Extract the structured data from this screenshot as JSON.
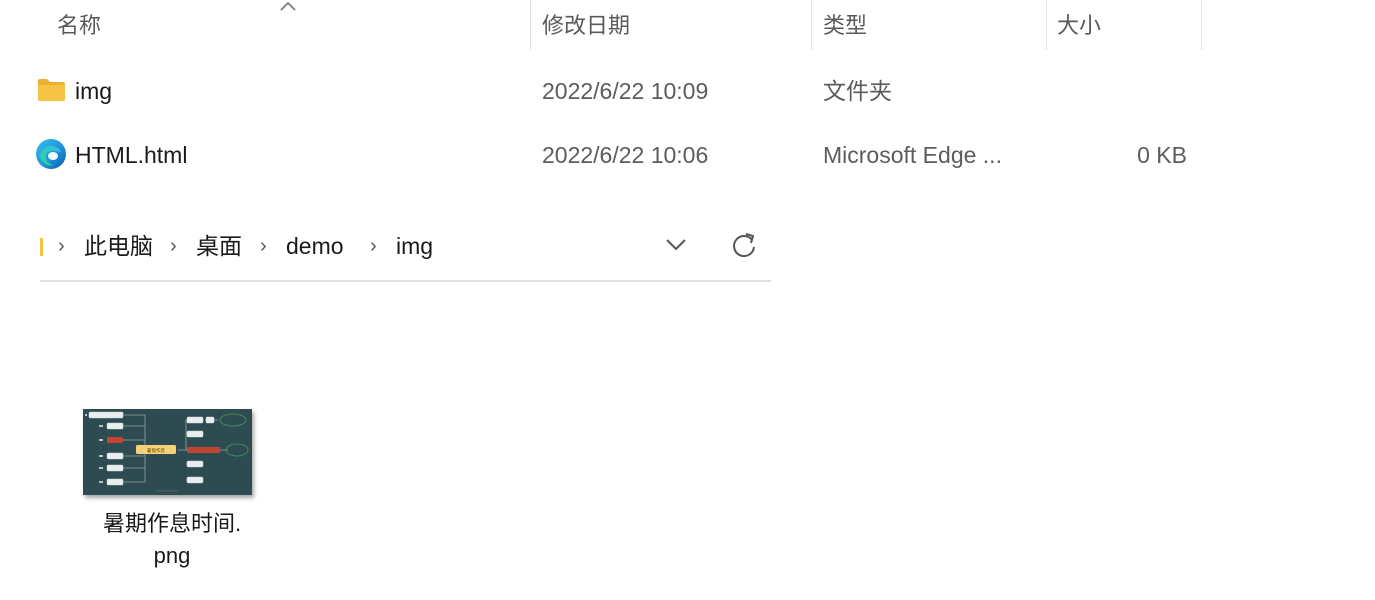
{
  "columns": {
    "name": "名称",
    "modified": "修改日期",
    "type": "类型",
    "size": "大小"
  },
  "files": [
    {
      "name": "img",
      "modified": "2022/6/22 10:09",
      "type": "文件夹",
      "size": "",
      "icon": "folder-icon"
    },
    {
      "name": "HTML.html",
      "modified": "2022/6/22 10:06",
      "type": "Microsoft Edge ...",
      "size": "0 KB",
      "icon": "edge-icon"
    }
  ],
  "breadcrumb": {
    "items": [
      "此电脑",
      "桌面",
      "demo",
      "img"
    ]
  },
  "thumbnail": {
    "label_line1": "暑期作息时间.",
    "label_line2": "png",
    "center_text": "暑假作息"
  },
  "colors": {
    "folder": "#f6c445",
    "thumb_bg": "#2f4b52",
    "thumb_center": "#f5d27a",
    "thumb_accent_red": "#c0442f",
    "thumb_accent_green": "#3d8a5a"
  }
}
